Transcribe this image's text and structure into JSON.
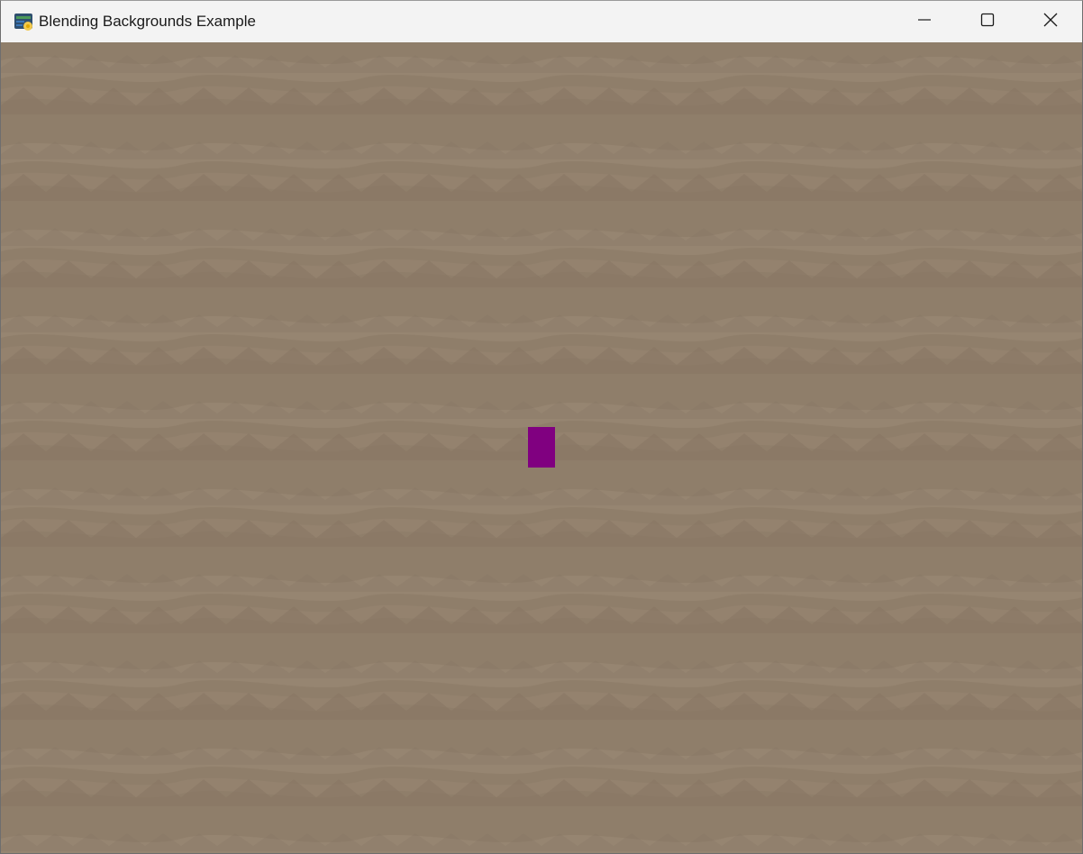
{
  "window": {
    "title": "Blending Backgrounds Example",
    "icon": "python-app-icon"
  },
  "titlebar_buttons": {
    "minimize": "minimize-icon",
    "maximize": "maximize-icon",
    "close": "close-icon"
  },
  "colors": {
    "titlebar": "#f3f3f3",
    "background_base": "#8f7e6a",
    "wave_light": "#9c8a76",
    "wave_dark": "#857461",
    "player": "#800080"
  }
}
